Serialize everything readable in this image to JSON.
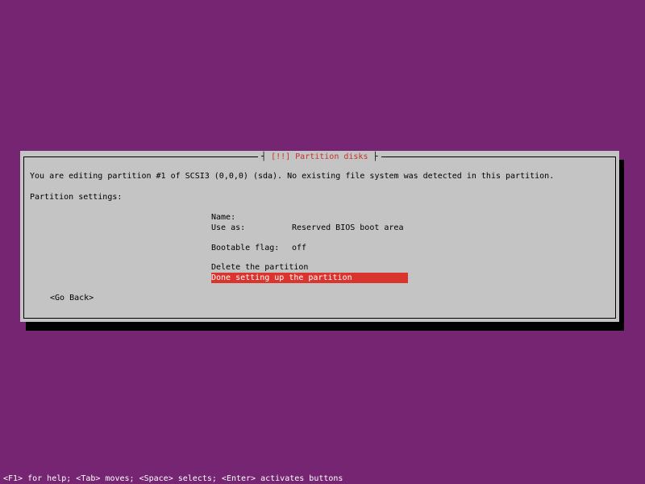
{
  "dialog": {
    "title": "[!!] Partition disks",
    "description": "You are editing partition #1 of SCSI3 (0,0,0) (sda). No existing file system was detected in this partition.",
    "settings_heading": "Partition settings:",
    "fields": [
      {
        "label": "Name:",
        "value": ""
      },
      {
        "label": "Use as:",
        "value": "Reserved BIOS boot area"
      },
      {
        "label": "Bootable flag:",
        "value": "off"
      }
    ],
    "actions": [
      {
        "label": "Delete the partition"
      },
      {
        "label": "Done setting up the partition",
        "selected": true
      }
    ],
    "go_back_label": "<Go Back>"
  },
  "statusbar": {
    "help_text": "<F1> for help; <Tab> moves; <Space> selects; <Enter> activates buttons"
  },
  "colors": {
    "background": "#752571",
    "dialog_bg": "#c4c4c4",
    "title_red": "#c8312b",
    "selection_bg": "#d9352e"
  }
}
